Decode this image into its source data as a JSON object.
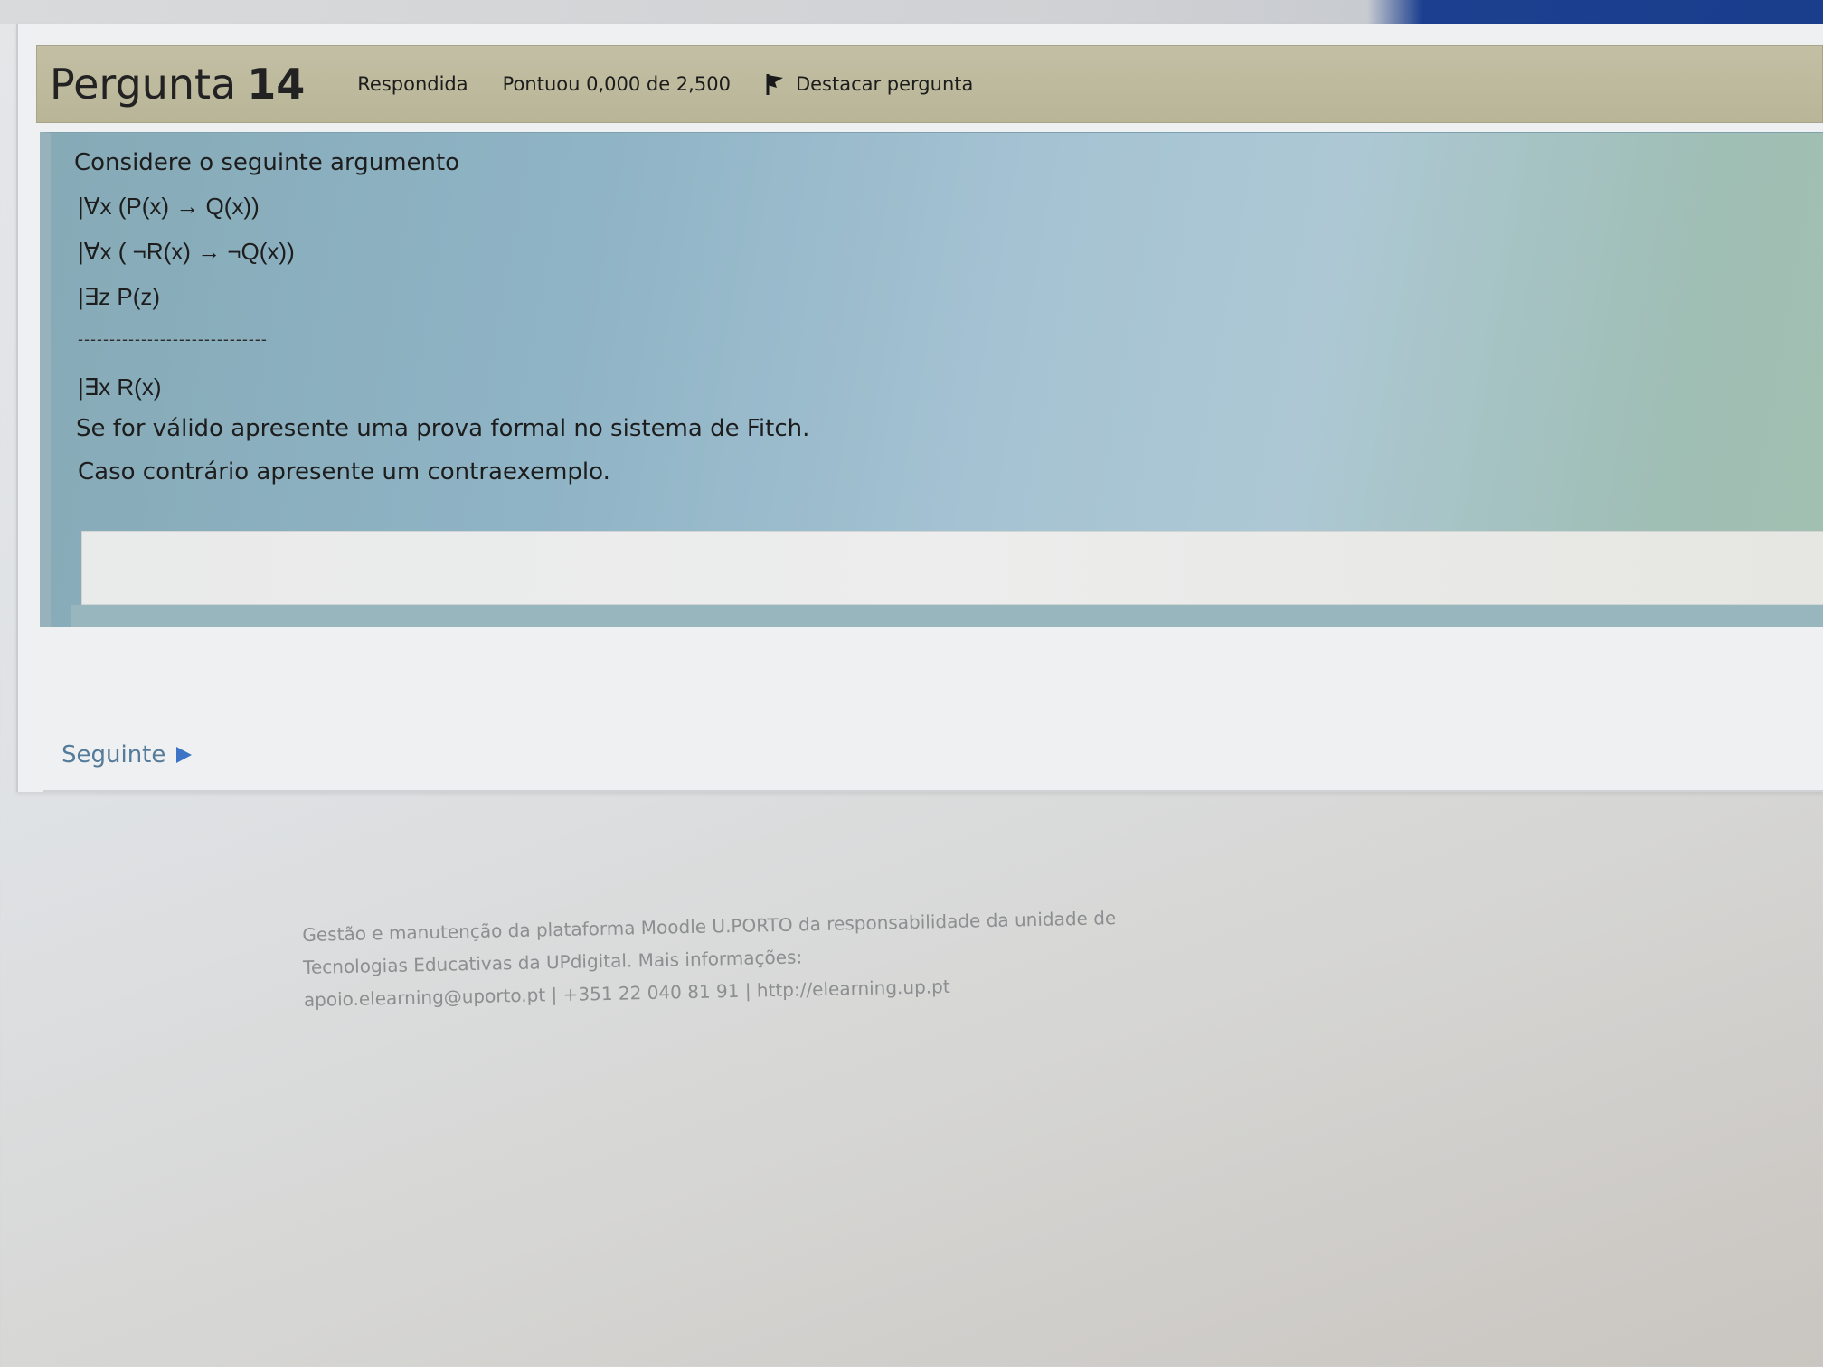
{
  "question": {
    "title": "Pergunta",
    "number": "14",
    "status": "Respondida",
    "score": "Pontuou 0,000 de 2,500",
    "flag_label": "Destacar pergunta"
  },
  "content": {
    "intro": "Considere o seguinte argumento",
    "premises": [
      "|∀x (P(x) → Q(x))",
      "|∀x ( ¬R(x) → ¬Q(x))",
      "|∃z P(z)"
    ],
    "separator": "------------------------------",
    "conclusion": "|∃x R(x)",
    "instruction_1": "Se for válido apresente uma prova formal no sistema de Fitch.",
    "instruction_2": "Caso contrário apresente um contraexemplo."
  },
  "navigation": {
    "next_label": "Seguinte"
  },
  "footer": {
    "line1": "Gestão e manutenção da plataforma Moodle U.PORTO da responsabilidade da unidade de",
    "line2": "Tecnologias Educativas da UPdigital. Mais informações:",
    "line3": "apoio.elearning@uporto.pt | +351 22 040 81 91 | http://elearning.up.pt"
  },
  "colors": {
    "header_bg": "#bdb99c",
    "content_bg": "#9fbecb",
    "link": "#557b9a",
    "next_arrow": "#3e74c6"
  },
  "icons": {
    "flag": "flag-icon",
    "next": "play-icon"
  }
}
